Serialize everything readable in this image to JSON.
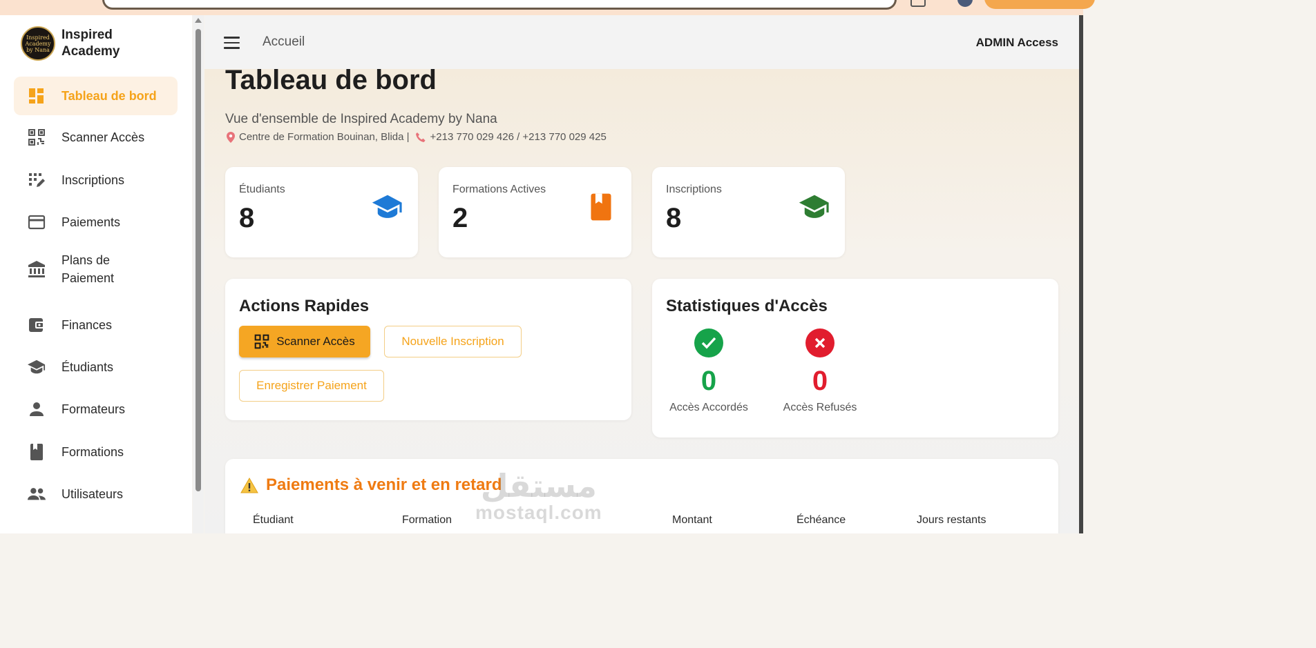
{
  "sidebar": {
    "brand_line1": "Inspired",
    "brand_line2": "Academy",
    "logo_text": "Inspired Academy by Nana",
    "items": [
      {
        "label": "Tableau de bord",
        "icon": "dashboard-icon",
        "active": true
      },
      {
        "label": "Scanner Accès",
        "icon": "qr-code-icon"
      },
      {
        "label": "Inscriptions",
        "icon": "edit-grid-icon"
      },
      {
        "label": "Paiements",
        "icon": "credit-card-icon"
      },
      {
        "label": "Plans de Paiement",
        "icon": "bank-icon"
      },
      {
        "label": "Finances",
        "icon": "wallet-icon"
      },
      {
        "label": "Étudiants",
        "icon": "graduation-cap-icon"
      },
      {
        "label": "Formateurs",
        "icon": "person-icon"
      },
      {
        "label": "Formations",
        "icon": "book-icon"
      },
      {
        "label": "Utilisateurs",
        "icon": "group-icon"
      }
    ]
  },
  "header": {
    "breadcrumb": "Accueil",
    "admin_label": "ADMIN Access"
  },
  "main": {
    "title": "Tableau de bord",
    "subtitle": "Vue d'ensemble de Inspired Academy by Nana",
    "address": "Centre de Formation Bouinan, Blida |",
    "phones": "+213 770 029 426 / +213 770 029 425",
    "stats": [
      {
        "label": "Étudiants",
        "value": "8",
        "icon": "graduation-cap-icon",
        "color": "#1e7ad6"
      },
      {
        "label": "Formations Actives",
        "value": "2",
        "icon": "book-icon",
        "color": "#f07410"
      },
      {
        "label": "Inscriptions",
        "value": "8",
        "icon": "graduation-cap-icon",
        "color": "#2e7d32"
      }
    ],
    "quick_actions": {
      "title": "Actions Rapides",
      "scan_label": "Scanner Accès",
      "new_inscription_label": "Nouvelle Inscription",
      "payment_label": "Enregistrer Paiement"
    },
    "access_stats": {
      "title": "Statistiques d'Accès",
      "granted_value": "0",
      "granted_label": "Accès Accordés",
      "granted_color": "#16a34a",
      "refused_value": "0",
      "refused_label": "Accès Refusés",
      "refused_color": "#e11d2e"
    },
    "payments": {
      "title": "Paiements à venir et en retard",
      "columns": [
        "Étudiant",
        "Formation",
        "Montant",
        "Échéance",
        "Jours restants"
      ]
    }
  },
  "watermark": {
    "arabic": "مستقل",
    "latin": "mostaql.com"
  }
}
